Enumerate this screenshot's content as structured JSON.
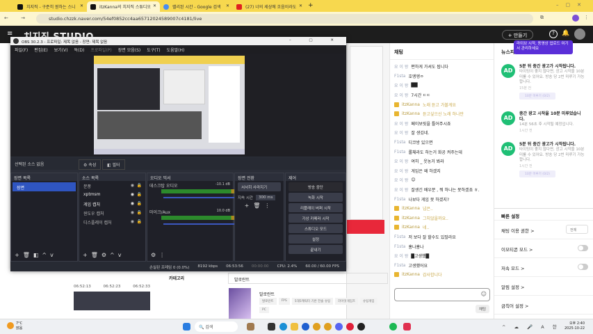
{
  "browser": {
    "tabs": [
      {
        "label": "치지직 - 구준히 뭔하는 스니"
      },
      {
        "label": "itzKanna의 치지직 스튜디오"
      },
      {
        "label": "랠리된 시간 - Google 검색"
      },
      {
        "label": "(27) 너의 세상에 흐음이라도"
      }
    ],
    "new_tab": "+",
    "url": "studio.chzzk.naver.com/54ef0852cc4aa65712024589007c4181/live",
    "window_controls": [
      "–",
      "▢",
      "✕"
    ]
  },
  "studio": {
    "logo": "치지직 STUDIO",
    "make_button": "+ 만들기",
    "help": "?"
  },
  "obs": {
    "title": "OBS 30.2.3 - 프로파일: 제목 없음 - 장면: 제목 없음",
    "menu": [
      "파일(F)",
      "편집(E)",
      "보기(V)",
      "독(D)",
      "프로파일(P)",
      "장면 모음(S)",
      "도구(T)",
      "도움말(H)"
    ],
    "no_source": "선택된 소스 없음",
    "props_button": "속성",
    "filter_button": "필터",
    "scenes_title": "장면 목록",
    "scenes": [
      "장면"
    ],
    "sources_title": "소스 목록",
    "sources": [
      "문풍",
      "xptmsm",
      "게임 캡처",
      "윈도우 캡처",
      "디스플레이 캡처"
    ],
    "mixer_title": "오디오 믹서",
    "mixer": [
      {
        "name": "데스크탑 오디오",
        "db": "-10.1 dB",
        "volume": 0.85
      },
      {
        "name": "마이크/Aux",
        "db": "10.0 dB",
        "volume": 1.0
      }
    ],
    "transition_title": "장면 전환",
    "transition": "서서히 사라지기",
    "duration_label": "지속 시간",
    "duration": "300 ms",
    "controls_title": "제어",
    "controls": [
      "방송 중단",
      "녹화 시작",
      "리플레이 버퍼 시작",
      "가상 카메라 시작",
      "스튜디오 모드",
      "설정",
      "끝내기"
    ],
    "status": {
      "dropped": "손실된 프레임 0 (0.0%)",
      "bitrate": "8192 kbps",
      "live_time": "06:53:56",
      "rec_time": "00:00:00",
      "cpu": "CPU: 2.4%",
      "fps": "60.00 / 60.00 FPS"
    }
  },
  "chat": {
    "title": "채팅",
    "messages": [
      {
        "nick": "요 이 왕",
        "text": "편하게 가셔도 됩니다",
        "streamer": false
      },
      {
        "nick": "F1sta",
        "text": "호엥엥ㅇ",
        "streamer": false
      },
      {
        "nick": "요 이 왕",
        "text": "██",
        "streamer": false
      },
      {
        "nick": "요 이 왕",
        "text": "7시간 ㄷㄷ",
        "streamer": false
      },
      {
        "nick": "itzKanna",
        "text": "노래 듣고 가볼게요",
        "streamer": true
      },
      {
        "nick": "itzKanna",
        "text": "듣고싶으신 노래 하나만",
        "streamer": true
      },
      {
        "nick": "요 이 왕",
        "text": "페이보릿을 틀어주시죠",
        "streamer": false
      },
      {
        "nick": "요 이 왕",
        "text": "잘 생깄네.",
        "streamer": false
      },
      {
        "nick": "F1sta",
        "text": "디코방 있으면",
        "streamer": false
      },
      {
        "nick": "F1sta",
        "text": "롤체라도 하는거 화공 켜주는데",
        "streamer": false
      },
      {
        "nick": "요 이 왕",
        "text": "여히 _ 웃농거 봐라",
        "streamer": false
      },
      {
        "nick": "요 이 왕",
        "text": "게임은 왜 하겠지",
        "streamer": false
      },
      {
        "nick": "요 이 왕",
        "text": "😊",
        "streamer": false
      },
      {
        "nick": "요 이 왕",
        "text": "잘생긴 배우분 , 뭐 하나는 못하겠죠 ㅎ.",
        "streamer": false
      },
      {
        "nick": "F1sta",
        "text": "나보다 게임 못 하겠지?",
        "streamer": false
      },
      {
        "nick": "itzKanna",
        "text": "넘은..",
        "streamer": true
      },
      {
        "nick": "itzKanna",
        "text": "그치않을까요..",
        "streamer": true
      },
      {
        "nick": "itzKanna",
        "text": "네..",
        "streamer": true
      },
      {
        "nick": "F1sta",
        "text": "저 보다 잘 할수도 있잖라요",
        "streamer": false
      },
      {
        "nick": "F1sta",
        "text": "홍나홍나",
        "streamer": false
      },
      {
        "nick": "요 이 왕",
        "text": "█고생했█",
        "streamer": false
      },
      {
        "nick": "F1sta",
        "text": "고생했어요",
        "streamer": false
      },
      {
        "nick": "itzKanna",
        "text": "감사합니다",
        "streamer": true
      }
    ],
    "send": "채팅"
  },
  "news": {
    "title": "뉴스피드",
    "tooltip": "라이브 시작, 동영상 업로드 여기서 관리하세요",
    "cards": [
      {
        "avatar": "AD",
        "title": "5분 뒤 중간 광고가 시작됩니다.",
        "body": "타이밍이 좋지 않다면, 광고 시작을 10분 미룰 수 있어요. 방송 당 2번 미루기 가능합니다.",
        "time": "15분 전",
        "button": "10분 미루기 (0/2)"
      },
      {
        "avatar": "AD",
        "title": "중간 광고 시작을 10분 미루었습니다.",
        "body": "14분 56초 후 시작될 예정입니다.",
        "time": "1시간 전",
        "button": ""
      },
      {
        "avatar": "AD",
        "title": "5분 뒤 중간 광고가 시작됩니다.",
        "body": "타이밍이 좋지 않다면, 광고 시작을 10분 미룰 수 있어요. 방송 당 2번 미루기 가능합니다.",
        "time": "1시간 전",
        "button": "10분 미루기 (0/2)"
      }
    ],
    "quick_title": "빠른 설정",
    "quick": [
      {
        "label": "채팅 이용 권한 >",
        "value": "전체",
        "type": "select"
      },
      {
        "label": "이모티콘 모드 >",
        "type": "toggle"
      },
      {
        "label": "저속 모드 >",
        "type": "toggle"
      },
      {
        "label": "알림 설정 >"
      },
      {
        "label": "금칙어 설정 >"
      }
    ]
  },
  "background": {
    "timeline": [
      "06:52:13",
      "06:52:23",
      "06:52:33"
    ],
    "category_label": "카테고리",
    "category_search": "발로란트",
    "game": "발로란트",
    "tags": [
      "발로란트",
      "FPS",
      "5대5캐릭터 기반 전술 슈팅",
      "라이엇게임즈",
      "슈팅게임",
      "PC"
    ]
  },
  "taskbar": {
    "weather_temp": "7°C",
    "weather_desc": "맑음",
    "search": "검색",
    "time": "오후 2:40",
    "date": "2025-10-22",
    "ime": "한",
    "lang": "A"
  }
}
